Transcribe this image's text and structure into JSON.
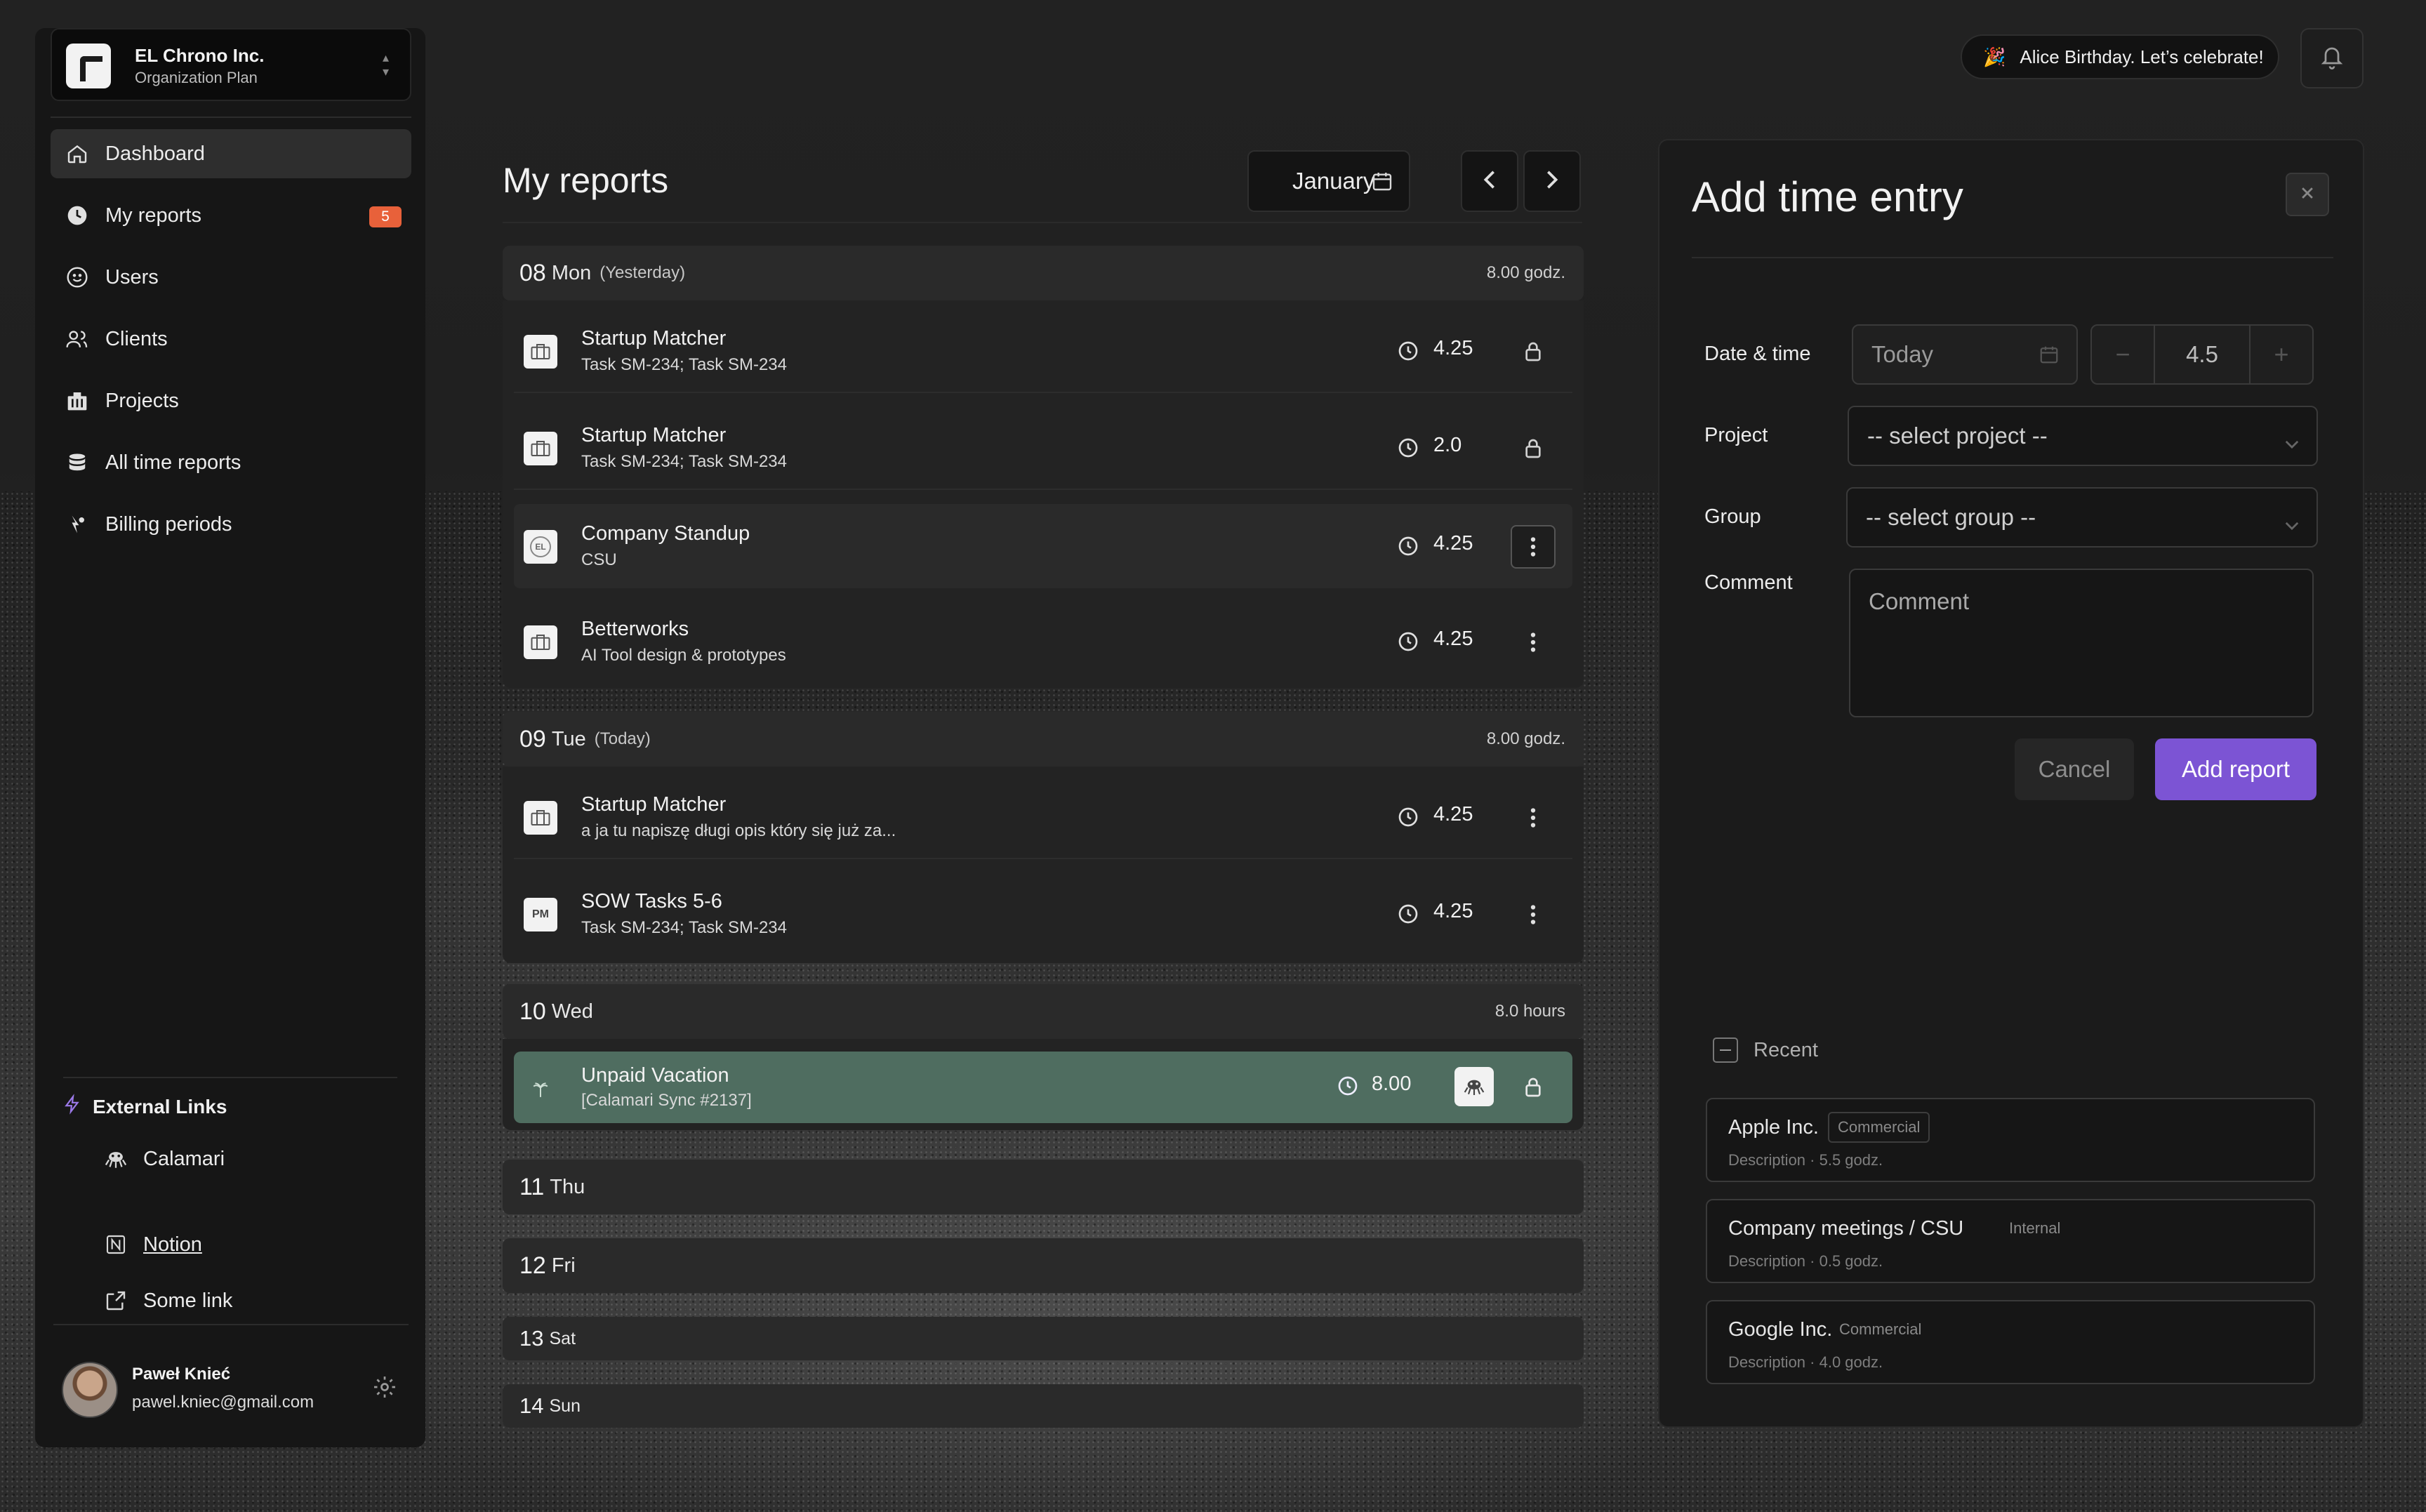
{
  "org": {
    "name": "EL Chrono Inc.",
    "plan": "Organization Plan"
  },
  "nav": [
    {
      "label": "Dashboard",
      "icon": "home-icon",
      "active": true
    },
    {
      "label": "My reports",
      "icon": "clock-icon",
      "badge": "5"
    },
    {
      "label": "Users",
      "icon": "smile-icon"
    },
    {
      "label": "Clients",
      "icon": "users-icon"
    },
    {
      "label": "Projects",
      "icon": "building-icon"
    },
    {
      "label": "All time reports",
      "icon": "database-icon"
    },
    {
      "label": "Billing periods",
      "icon": "billing-icon"
    }
  ],
  "external": {
    "title": "External Links",
    "items": [
      {
        "label": "Calamari",
        "icon": "calamari-icon"
      },
      {
        "label": "Notion",
        "icon": "notion-icon"
      },
      {
        "label": "Some link",
        "icon": "external-link-icon"
      }
    ]
  },
  "user": {
    "name": "Paweł Knieć",
    "email": "pawel.kniec@gmail.com"
  },
  "announcement": {
    "emoji": "🎉",
    "text": "Alice Birthday. Let’s celebrate!"
  },
  "main": {
    "title": "My reports",
    "month": "January",
    "days": [
      {
        "num": "08",
        "name": "Mon",
        "rel": "(Yesterday)",
        "total": "8.00 godz.",
        "entries": [
          {
            "project": "Startup Matcher",
            "desc": "Task SM-234; Task SM-234",
            "hours": "4.25",
            "action": "lock"
          },
          {
            "project": "Startup Matcher",
            "desc": "Task SM-234; Task SM-234",
            "hours": "2.0",
            "action": "lock"
          },
          {
            "project": "Company Standup",
            "desc": "CSU",
            "hours": "4.25",
            "action": "menu",
            "icon_text": "EL"
          },
          {
            "project": "Betterworks",
            "desc": "AI Tool design & prototypes",
            "hours": "4.25",
            "action": "menu"
          }
        ]
      },
      {
        "num": "09",
        "name": "Tue",
        "rel": "(Today)",
        "total": "8.00 godz.",
        "entries": [
          {
            "project": "Startup Matcher",
            "desc": "a ja tu napiszę długi opis który się już za...",
            "hours": "4.25",
            "action": "menu"
          },
          {
            "project": "SOW Tasks 5-6",
            "desc": "Task SM-234; Task SM-234",
            "hours": "4.25",
            "action": "menu",
            "icon_text": "PM"
          }
        ]
      },
      {
        "num": "10",
        "name": "Wed",
        "rel": "",
        "total": "8.0 hours",
        "entries": [
          {
            "project": "Unpaid Vacation",
            "desc": "[Calamari Sync #2137]",
            "hours": "8.00",
            "action": "lock"
          }
        ]
      },
      {
        "num": "11",
        "name": "Thu"
      },
      {
        "num": "12",
        "name": "Fri"
      },
      {
        "num": "13",
        "name": "Sat"
      },
      {
        "num": "14",
        "name": "Sun"
      }
    ]
  },
  "panel": {
    "title": "Add time entry",
    "date_label": "Date & time",
    "date_value": "Today",
    "duration": "4.5",
    "stepper_minus": "−",
    "stepper_plus": "+",
    "project_label": "Project",
    "project_placeholder": "-- select project --",
    "group_label": "Group",
    "group_placeholder": "-- select group --",
    "comment_label": "Comment",
    "comment_placeholder": "Comment",
    "cancel": "Cancel",
    "submit": "Add report",
    "recent_title": "Recent",
    "recent": [
      {
        "name": "Apple Inc.",
        "tag": "Commercial",
        "desc": "Description · 5.5 godz."
      },
      {
        "name": "Company meetings / CSU",
        "tag": "Internal",
        "desc": "Description · 0.5 godz."
      },
      {
        "name": "Google Inc.",
        "tag": "Commercial",
        "desc": "Description · 4.0 godz."
      }
    ]
  },
  "colors": {
    "accent": "#7c54d4",
    "badge": "#e8613a",
    "vacation": "#4f6d60"
  }
}
